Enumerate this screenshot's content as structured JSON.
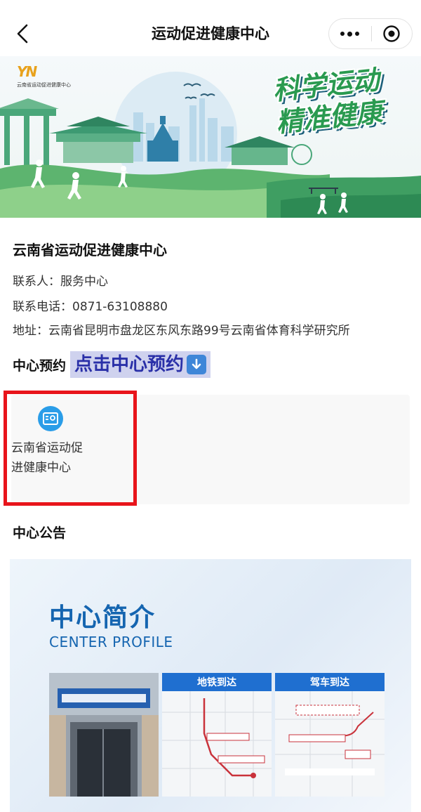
{
  "nav": {
    "title": "运动促进健康中心",
    "back_icon": "chevron-left-icon",
    "more_icon": "more-dots-icon",
    "close_icon": "target-circle-icon"
  },
  "banner": {
    "logo_mark": "YN",
    "logo_text": "云南省运动促进健康中心",
    "slogan_line1": "科学运动",
    "slogan_line2": "精准健康"
  },
  "info": {
    "name": "云南省运动促进健康中心",
    "contact": "联系人：服务中心",
    "phone": "联系电话：0871-63108880",
    "address": "地址：云南省昆明市盘龙区东风东路99号云南省体育科学研究所"
  },
  "reserve": {
    "label": "中心预约",
    "link_text": "点击中心预约",
    "down_icon": "down-arrow-icon"
  },
  "service_card": {
    "icon": "id-card-icon",
    "name": "云南省运动促进健康中心"
  },
  "notice": {
    "title": "中心公告"
  },
  "profile": {
    "title": "中心简介",
    "subtitle": "CENTER PROFILE",
    "metro_label": "地铁到达",
    "drive_label": "驾车到达"
  },
  "colors": {
    "accent_blue": "#1565b0",
    "highlight_red": "#e8141b",
    "slogan_green": "#2a9a50"
  }
}
